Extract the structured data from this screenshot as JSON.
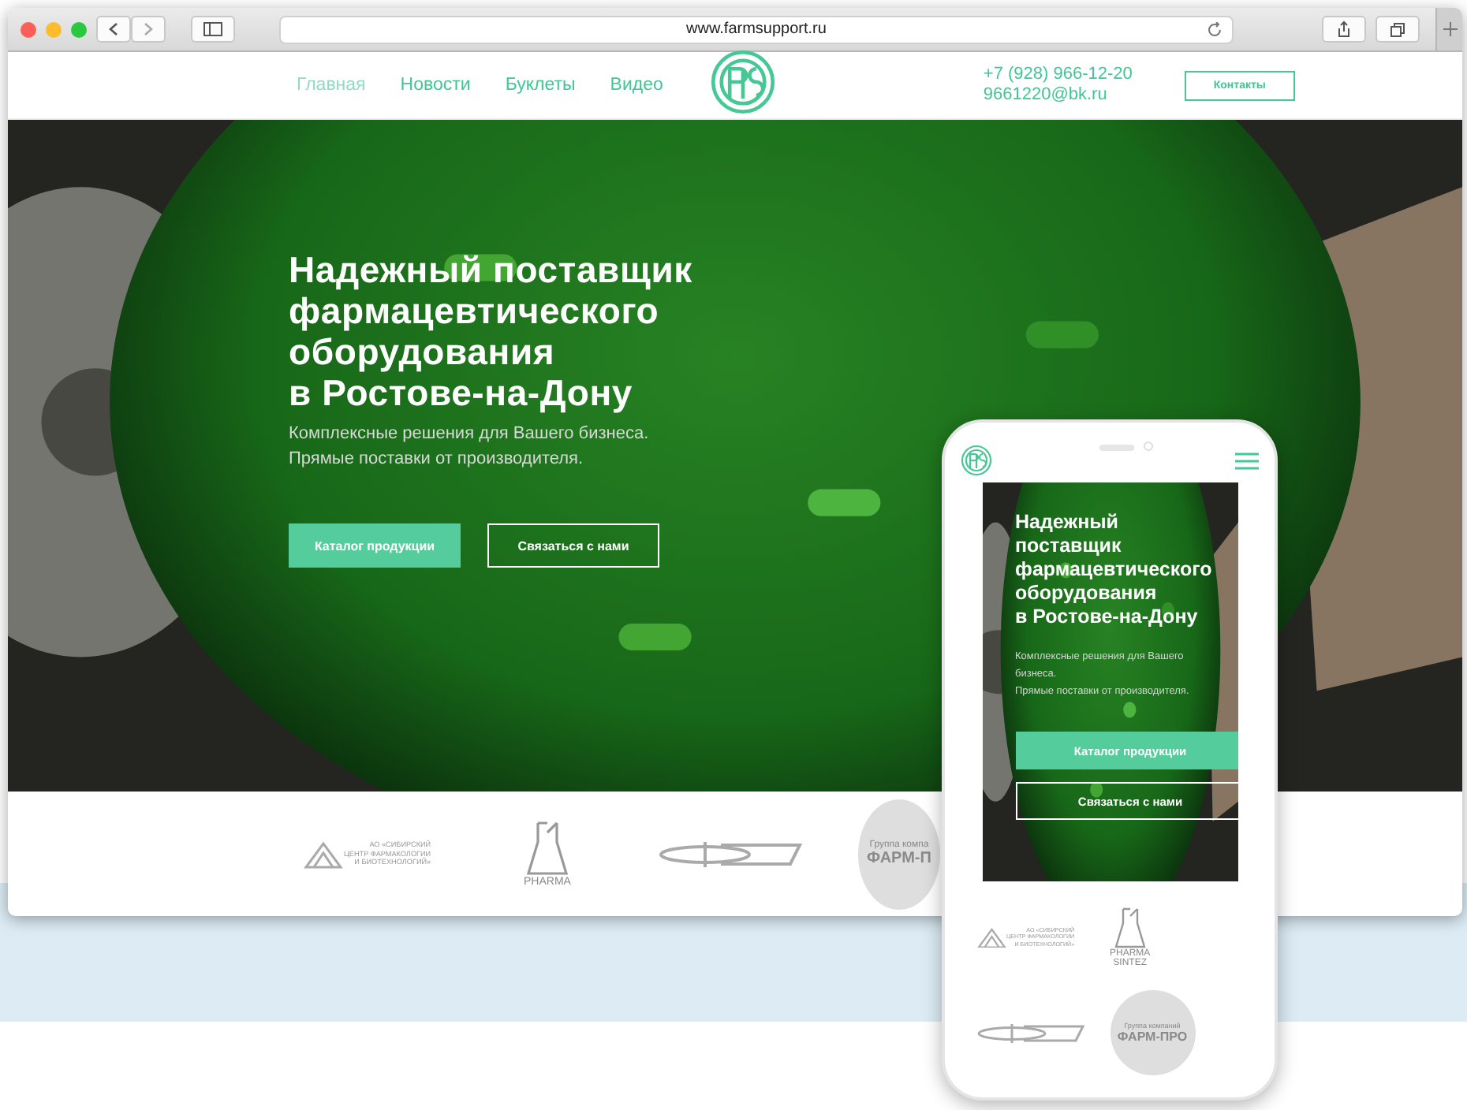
{
  "browser": {
    "url": "www.farmsupport.ru"
  },
  "nav": {
    "links": [
      {
        "label": "Главная",
        "selected": true
      },
      {
        "label": "Новости",
        "selected": false
      },
      {
        "label": "Буклеты",
        "selected": false
      },
      {
        "label": "Видео",
        "selected": false
      }
    ],
    "phone": "+7 (928) 966-12-20",
    "email": "9661220@bk.ru",
    "contact_button": "Контакты"
  },
  "hero": {
    "title_lines": [
      "Надежный поставщик",
      "фармацевтического",
      "оборудования",
      "в Ростове-на-Дону"
    ],
    "subtitle_lines": [
      "Комплексные решения для Вашего бизнеса.",
      "Прямые поставки от производителя."
    ],
    "primary_button": "Каталог продукции",
    "secondary_button": "Связаться с нами"
  },
  "partners": [
    {
      "kind": "center",
      "lines": [
        "АО «СИБИРСКИЙ",
        "ЦЕНТР ФАРМАКОЛОГИИ",
        "И БИОТЕХНОЛОГИЙ»"
      ]
    },
    {
      "kind": "flask",
      "lines": [
        "PHARMA"
      ]
    },
    {
      "kind": "swoosh"
    },
    {
      "kind": "circle",
      "lines": [
        "Группа компа",
        "ФАРМ-П"
      ]
    }
  ],
  "mobile": {
    "title_lines": [
      "Надежный",
      "поставщик",
      "фармацевтического",
      "оборудования",
      "в Ростове-на-Дону"
    ],
    "subtitle_lines": [
      "Комплексные решения для Вашего",
      "бизнеса.",
      "Прямые поставки от производителя."
    ],
    "primary_button": "Каталог продукции",
    "secondary_button": "Связаться с нами",
    "partners": [
      {
        "kind": "center",
        "lines": [
          "АО «СИБИРСКИЙ",
          "ЦЕНТР ФАРМАКОЛОГИИ",
          "И БИОТЕХНОЛОГИЙ»"
        ]
      },
      {
        "kind": "flask",
        "lines": [
          "PHARMA",
          "SINTEZ"
        ]
      },
      {
        "kind": "swoosh"
      },
      {
        "kind": "circle",
        "lines": [
          "Группа компаний",
          "ФАРМ-ПРО"
        ]
      }
    ]
  }
}
